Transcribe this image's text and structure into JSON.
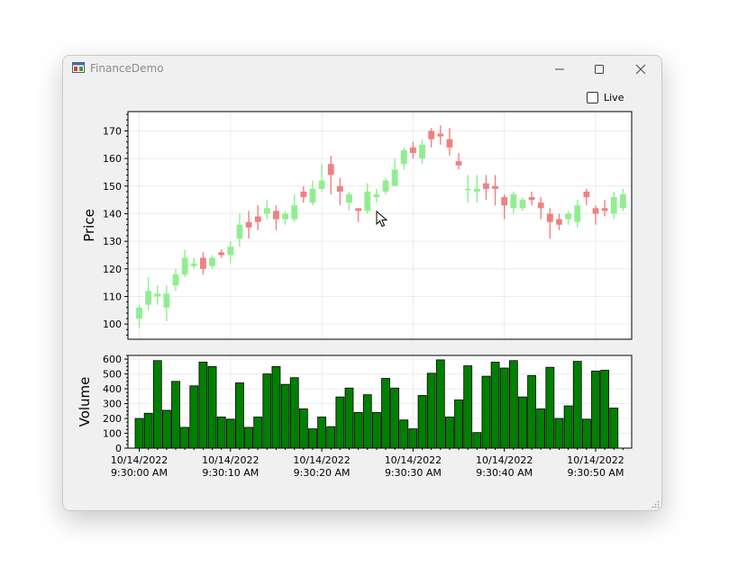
{
  "window": {
    "title": "FinanceDemo",
    "icon": "app-window-icon",
    "controls": [
      "minimize-icon",
      "maximize-icon",
      "close-icon"
    ]
  },
  "live_toggle": {
    "label": "Live",
    "checked": false
  },
  "colors": {
    "up": "#90ee90",
    "down": "#f08080",
    "volume": "#008000",
    "volume_edge": "#000000"
  },
  "chart_data": [
    {
      "type": "candlestick",
      "title": "",
      "ylabel": "Price",
      "ylim": [
        94.5,
        177
      ],
      "y_ticks": [
        100,
        110,
        120,
        130,
        140,
        150,
        160,
        170
      ],
      "grid": true,
      "x": [
        "9:30:00",
        "9:30:01",
        "9:30:02",
        "9:30:03",
        "9:30:04",
        "9:30:05",
        "9:30:06",
        "9:30:07",
        "9:30:08",
        "9:30:09",
        "9:30:10",
        "9:30:11",
        "9:30:12",
        "9:30:13",
        "9:30:14",
        "9:30:15",
        "9:30:16",
        "9:30:17",
        "9:30:18",
        "9:30:19",
        "9:30:20",
        "9:30:21",
        "9:30:22",
        "9:30:23",
        "9:30:24",
        "9:30:25",
        "9:30:26",
        "9:30:27",
        "9:30:28",
        "9:30:29",
        "9:30:30",
        "9:30:31",
        "9:30:32",
        "9:30:33",
        "9:30:34",
        "9:30:35",
        "9:30:36",
        "9:30:37",
        "9:30:38",
        "9:30:39",
        "9:30:40",
        "9:30:41",
        "9:30:42",
        "9:30:43",
        "9:30:44",
        "9:30:45",
        "9:30:46",
        "9:30:47",
        "9:30:48",
        "9:30:49",
        "9:30:50",
        "9:30:51",
        "9:30:52",
        "9:30:53"
      ],
      "ohlc": [
        [
          102,
          107,
          98.5,
          106
        ],
        [
          107,
          117,
          105,
          112
        ],
        [
          110,
          114,
          107,
          111
        ],
        [
          106,
          114,
          101,
          111
        ],
        [
          114,
          120,
          112,
          118
        ],
        [
          118,
          127,
          117,
          124
        ],
        [
          121,
          124,
          120,
          122
        ],
        [
          124,
          126,
          118,
          120
        ],
        [
          121,
          125,
          120,
          124
        ],
        [
          126,
          127,
          124,
          125
        ],
        [
          125,
          130,
          122,
          128
        ],
        [
          131,
          140,
          128,
          136
        ],
        [
          137,
          141,
          131,
          135
        ],
        [
          139,
          143,
          134,
          137
        ],
        [
          140,
          145,
          138,
          142
        ],
        [
          141,
          143,
          134,
          138
        ],
        [
          138,
          141,
          136,
          140
        ],
        [
          138,
          147,
          137,
          143
        ],
        [
          148,
          150,
          144,
          146
        ],
        [
          144,
          152,
          143,
          149
        ],
        [
          149,
          158,
          148,
          152
        ],
        [
          158,
          161,
          147,
          154
        ],
        [
          150,
          153,
          143,
          148
        ],
        [
          144,
          148,
          141,
          147
        ],
        [
          142,
          142,
          137,
          141
        ],
        [
          141,
          151,
          140,
          148
        ],
        [
          146,
          149,
          144,
          147
        ],
        [
          148,
          153,
          147,
          152
        ],
        [
          150,
          160,
          150,
          156
        ],
        [
          158,
          164,
          156,
          163
        ],
        [
          164,
          166,
          160,
          162
        ],
        [
          160,
          167,
          158,
          165
        ],
        [
          170,
          171,
          164,
          167
        ],
        [
          169,
          172,
          165,
          168
        ],
        [
          167,
          171,
          161,
          164
        ],
        [
          159,
          162,
          156,
          157.5
        ],
        [
          149,
          154,
          144,
          149
        ],
        [
          148,
          154,
          144,
          149
        ],
        [
          151,
          154,
          145,
          149
        ],
        [
          150,
          154,
          143,
          149
        ],
        [
          146,
          147,
          138,
          143
        ],
        [
          142,
          148,
          140,
          147
        ],
        [
          142,
          146,
          141,
          145
        ],
        [
          146,
          148,
          143,
          145
        ],
        [
          144,
          146,
          138,
          142
        ],
        [
          140,
          142,
          131,
          137
        ],
        [
          138,
          140,
          134,
          136
        ],
        [
          138,
          141,
          136,
          140
        ],
        [
          137,
          145,
          135,
          143
        ],
        [
          148,
          149,
          143,
          146
        ],
        [
          142,
          143,
          136,
          140
        ],
        [
          142,
          145,
          139,
          141
        ],
        [
          140,
          148,
          138,
          146
        ],
        [
          142,
          149,
          141,
          147
        ]
      ]
    },
    {
      "type": "bar",
      "ylabel": "Volume",
      "ylim": [
        0,
        625
      ],
      "y_ticks": [
        0,
        100,
        200,
        300,
        400,
        500,
        600
      ],
      "values": [
        200,
        235,
        590,
        255,
        450,
        140,
        420,
        580,
        550,
        210,
        195,
        440,
        140,
        210,
        500,
        550,
        430,
        475,
        265,
        130,
        210,
        145,
        345,
        405,
        240,
        360,
        240,
        470,
        405,
        190,
        130,
        355,
        505,
        595,
        210,
        325,
        555,
        105,
        485,
        580,
        540,
        590,
        345,
        490,
        265,
        545,
        200,
        285,
        585,
        195,
        520,
        525,
        270
      ],
      "x_tick_labels": [
        [
          "10/14/2022",
          "9:30:00 AM"
        ],
        [
          "10/14/2022",
          "9:30:10 AM"
        ],
        [
          "10/14/2022",
          "9:30:20 AM"
        ],
        [
          "10/14/2022",
          "9:30:30 AM"
        ],
        [
          "10/14/2022",
          "9:30:40 AM"
        ],
        [
          "10/14/2022",
          "9:30:50 AM"
        ]
      ]
    }
  ]
}
